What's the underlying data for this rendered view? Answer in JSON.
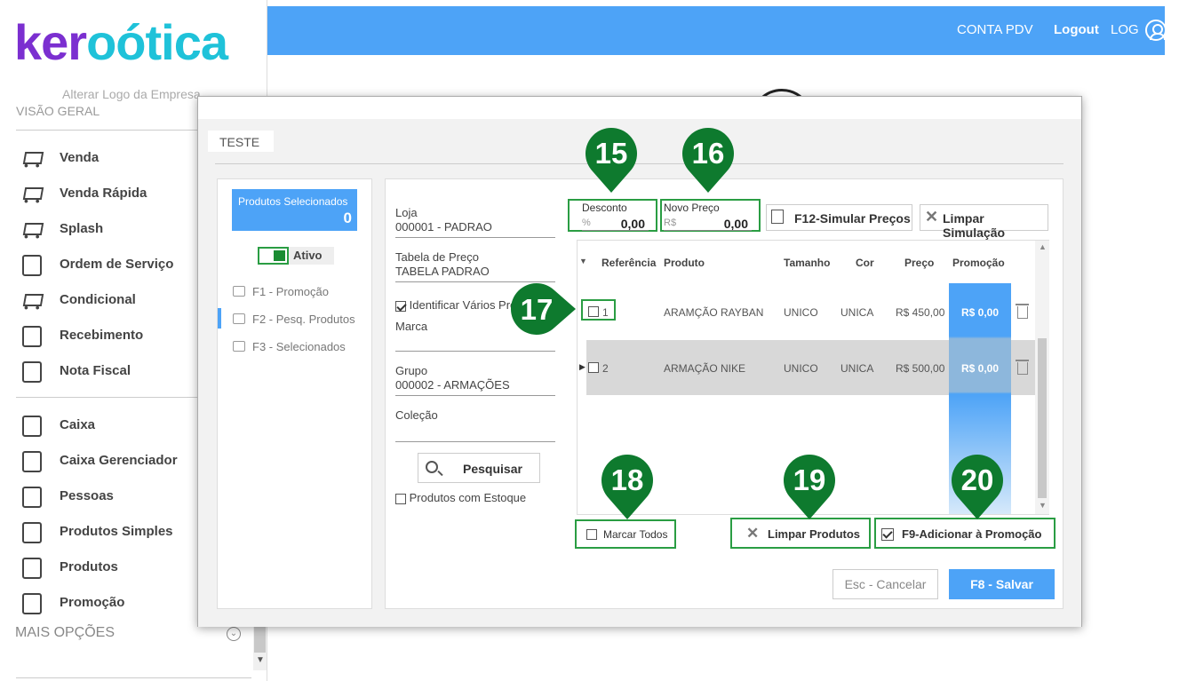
{
  "header": {
    "conta_pdv": "CONTA PDV",
    "logout": "Logout",
    "user": "LOG"
  },
  "sidebar": {
    "logo_part1": "ker",
    "logo_part2": "oótica",
    "alter_logo": "Alterar Logo da Empresa",
    "section_title": "VISÃO GERAL",
    "items": [
      {
        "label": "Venda",
        "icon": "cart-icon"
      },
      {
        "label": "Venda Rápida",
        "icon": "cart-fast-icon"
      },
      {
        "label": "Splash",
        "icon": "cart-dollar-icon"
      },
      {
        "label": "Ordem de Serviço",
        "icon": "wrench-icon"
      },
      {
        "label": "Condicional",
        "icon": "cart-arrows-icon"
      },
      {
        "label": "Recebimento",
        "icon": "hand-money-icon"
      },
      {
        "label": "Nota Fiscal",
        "icon": "nfe-icon"
      }
    ],
    "items2": [
      {
        "label": "Caixa",
        "icon": "cash-register-icon"
      },
      {
        "label": "Caixa Gerenciador",
        "icon": "user-money-icon"
      },
      {
        "label": "Pessoas",
        "icon": "people-icon"
      },
      {
        "label": "Produtos Simples",
        "icon": "box-icon"
      },
      {
        "label": "Produtos",
        "icon": "box-icon"
      },
      {
        "label": "Promoção",
        "icon": "tag-percent-icon"
      }
    ],
    "more": "MAIS OPÇÕES"
  },
  "modal": {
    "title": "TESTE",
    "selected": {
      "label": "Produtos Selecionados",
      "count": "0"
    },
    "toggle_label": "Ativo",
    "nav": [
      {
        "label": "F1 - Promoção"
      },
      {
        "label": "F2 - Pesq. Produtos"
      },
      {
        "label": "F3 - Selecionados"
      }
    ],
    "filters": {
      "loja_label": "Loja",
      "loja_value": "000001 - PADRAO",
      "tabela_label": "Tabela de Preço",
      "tabela_value": "TABELA PADRAO",
      "identificar_label": "Identificar Vários Pro",
      "marca_label": "Marca",
      "marca_value": "",
      "grupo_label": "Grupo",
      "grupo_value": "000002 - ARMAÇÕES",
      "colecao_label": "Coleção",
      "colecao_value": "",
      "pesquisar": "Pesquisar",
      "estoque_label": "Produtos com Estoque"
    },
    "desconto": {
      "label": "Desconto",
      "prefix": "%",
      "value": "0,00"
    },
    "novo_preco": {
      "label": "Novo Preço",
      "prefix": "R$",
      "value": "0,00"
    },
    "simular": "F12-Simular Preços",
    "limpar_simulacao": "Limpar Simulação",
    "table": {
      "headers": [
        "Referência",
        "Produto",
        "Tamanho",
        "Cor",
        "Preço",
        "Promoção"
      ],
      "rows": [
        {
          "ref": "1",
          "produto": "ARAMÇÃO RAYBAN",
          "tamanho": "UNICO",
          "cor": "UNICA",
          "preco": "R$ 450,00",
          "promocao": "R$ 0,00"
        },
        {
          "ref": "2",
          "produto": "ARMAÇÃO NIKE",
          "tamanho": "UNICO",
          "cor": "UNICA",
          "preco": "R$ 500,00",
          "promocao": "R$ 0,00"
        }
      ]
    },
    "marcar_todos": "Marcar Todos",
    "limpar_produtos": "Limpar Produtos",
    "adicionar": "F9-Adicionar à Promoção",
    "cancelar": "Esc - Cancelar",
    "salvar": "F8 - Salvar"
  },
  "markers": [
    "15",
    "16",
    "17",
    "18",
    "19",
    "20"
  ],
  "colors": {
    "accent": "#4da3f7",
    "marker": "#0e7a2e",
    "highlight": "#2a9d43",
    "logo_purple": "#7b2fd0",
    "logo_cyan": "#1fc2d9"
  }
}
